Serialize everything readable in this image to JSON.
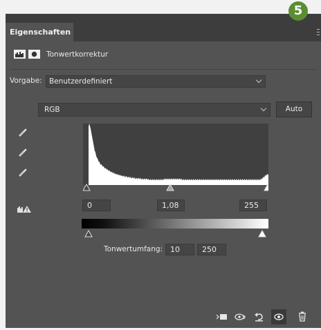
{
  "badge": "5",
  "panel": {
    "tab_title": "Eigenschaften",
    "header_title": "Tonwertkorrektur",
    "preset_label": "Vorgabe:",
    "preset_value": "Benutzerdefiniert",
    "channel_value": "RGB",
    "auto_label": "Auto",
    "input_levels": {
      "black": "0",
      "gamma": "1,08",
      "white": "255"
    },
    "output_label": "Tonwertumfang:",
    "output_levels": {
      "black": "10",
      "white": "250"
    }
  },
  "histogram": {
    "description_free": true,
    "profile": [
      95,
      100,
      96,
      92,
      86,
      80,
      74,
      68,
      62,
      57,
      53,
      49,
      46,
      43,
      41,
      39,
      37,
      35,
      34,
      33,
      32,
      31,
      30,
      29,
      28,
      27,
      27,
      26,
      25,
      24,
      24,
      23,
      22,
      22,
      21,
      21,
      20,
      20,
      19,
      19,
      18,
      18,
      18,
      17,
      17,
      17,
      16,
      16,
      16,
      15,
      15,
      15,
      15,
      14,
      14,
      14,
      14,
      13,
      13,
      13,
      13,
      13,
      12,
      12,
      12,
      12,
      12,
      12,
      11,
      11,
      11,
      11,
      11,
      11,
      11,
      11,
      11,
      10,
      10,
      10,
      10,
      10,
      10,
      10,
      10,
      10,
      10,
      10,
      9,
      9,
      9,
      9,
      9,
      9,
      9,
      9,
      9,
      9,
      9,
      9,
      9,
      9,
      9,
      9,
      9,
      9,
      9,
      9,
      9,
      9,
      9,
      10,
      10,
      10,
      10,
      10,
      10,
      10,
      10,
      10,
      10,
      10,
      10,
      10,
      10,
      10,
      10,
      10,
      10,
      10,
      10,
      10,
      10,
      10,
      10,
      10,
      10,
      9,
      9,
      9,
      9,
      9,
      9,
      9,
      9,
      9,
      9,
      9,
      9,
      9,
      9,
      9,
      9,
      9,
      9,
      9,
      9,
      9,
      9,
      9,
      9,
      9,
      9,
      9,
      9,
      9,
      9,
      9,
      9,
      9,
      9,
      9,
      9,
      9,
      9,
      9,
      9,
      9,
      9,
      9,
      9,
      9,
      9,
      9,
      9,
      9,
      9,
      9,
      9,
      9,
      9,
      9,
      9,
      9,
      9,
      9,
      9,
      9,
      9,
      9,
      9,
      9,
      9,
      9,
      9,
      9,
      9,
      9,
      9,
      9,
      9,
      9,
      9,
      9,
      9,
      9,
      9,
      9,
      9,
      9,
      9,
      9,
      9,
      9,
      9,
      9,
      9,
      9,
      9,
      9,
      9,
      9,
      9,
      9,
      9,
      9,
      9,
      9,
      9,
      9,
      9,
      9,
      9,
      9,
      9,
      9,
      9,
      9,
      9,
      9,
      9,
      9,
      9,
      10,
      10,
      11,
      12,
      13,
      14,
      15,
      16,
      17,
      17,
      18,
      18
    ]
  },
  "colors": {
    "panel": "#535353",
    "tabbar": "#3d3d3d",
    "badge": "#5b8e32",
    "field": "#454545"
  },
  "icons": {
    "bottom": [
      "clip-to-layer-icon",
      "view-previous-state-icon",
      "reset-icon",
      "visibility-eye-icon",
      "trash-icon"
    ],
    "pickers": [
      "black-point-eyedropper-icon",
      "gray-point-eyedropper-icon",
      "white-point-eyedropper-icon"
    ]
  }
}
